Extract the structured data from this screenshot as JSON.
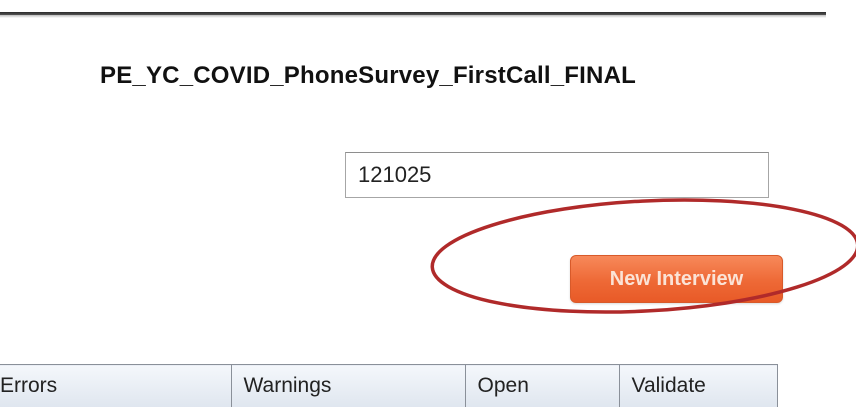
{
  "survey": {
    "title": "PE_YC_COVID_PhoneSurvey_FirstCall_FINAL"
  },
  "interview_id_field": {
    "value": "121025"
  },
  "actions": {
    "new_interview_label": "New Interview"
  },
  "annotation": {
    "color": "#b02a2a",
    "shape": "ellipse"
  },
  "table": {
    "columns": [
      "Errors",
      "Warnings",
      "Open",
      "Validate"
    ]
  },
  "colors": {
    "button_accent": "#ee6936",
    "header_bg": "#e6ecf3"
  }
}
